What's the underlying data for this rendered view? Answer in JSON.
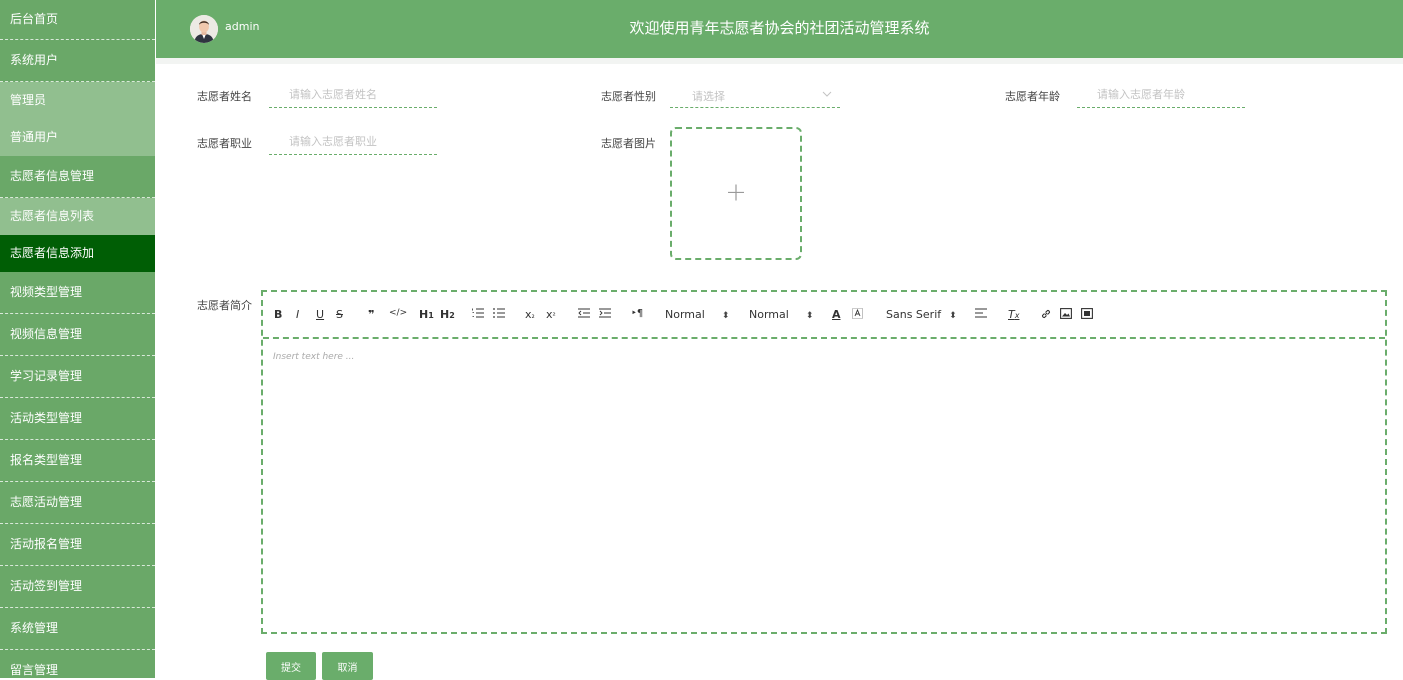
{
  "header": {
    "username": "admin",
    "title": "欢迎使用青年志愿者协会的社团活动管理系统"
  },
  "sidebar": {
    "items": [
      {
        "label": "后台首页",
        "kind": "top"
      },
      {
        "label": "系统用户",
        "kind": "group"
      },
      {
        "label": "管理员",
        "kind": "sub"
      },
      {
        "label": "普通用户",
        "kind": "sub"
      },
      {
        "label": "志愿者信息管理",
        "kind": "group"
      },
      {
        "label": "志愿者信息列表",
        "kind": "sub"
      },
      {
        "label": "志愿者信息添加",
        "kind": "active"
      },
      {
        "label": "视频类型管理",
        "kind": "group"
      },
      {
        "label": "视频信息管理",
        "kind": "group"
      },
      {
        "label": "学习记录管理",
        "kind": "group"
      },
      {
        "label": "活动类型管理",
        "kind": "group"
      },
      {
        "label": "报名类型管理",
        "kind": "group"
      },
      {
        "label": "志愿活动管理",
        "kind": "group"
      },
      {
        "label": "活动报名管理",
        "kind": "group"
      },
      {
        "label": "活动签到管理",
        "kind": "group"
      },
      {
        "label": "系统管理",
        "kind": "group"
      },
      {
        "label": "留言管理",
        "kind": "group"
      }
    ]
  },
  "form": {
    "name_label": "志愿者姓名",
    "name_placeholder": "请输入志愿者姓名",
    "gender_label": "志愿者性别",
    "gender_placeholder": "请选择",
    "age_label": "志愿者年龄",
    "age_placeholder": "请输入志愿者年龄",
    "job_label": "志愿者职业",
    "job_placeholder": "请输入志愿者职业",
    "photo_label": "志愿者图片",
    "intro_label": "志愿者简介"
  },
  "editor": {
    "placeholder": "Insert text here ...",
    "header_select": "Normal",
    "size_select": "Normal",
    "font_select": "Sans Serif"
  },
  "buttons": {
    "submit": "提交",
    "cancel": "取消"
  },
  "colors": {
    "sidebar_bg": "#6aa868",
    "sidebar_sub_bg": "#91bf8f",
    "sidebar_active_bg": "#005e05",
    "header_bg": "#6aad6b",
    "accent": "#6aad6b"
  }
}
